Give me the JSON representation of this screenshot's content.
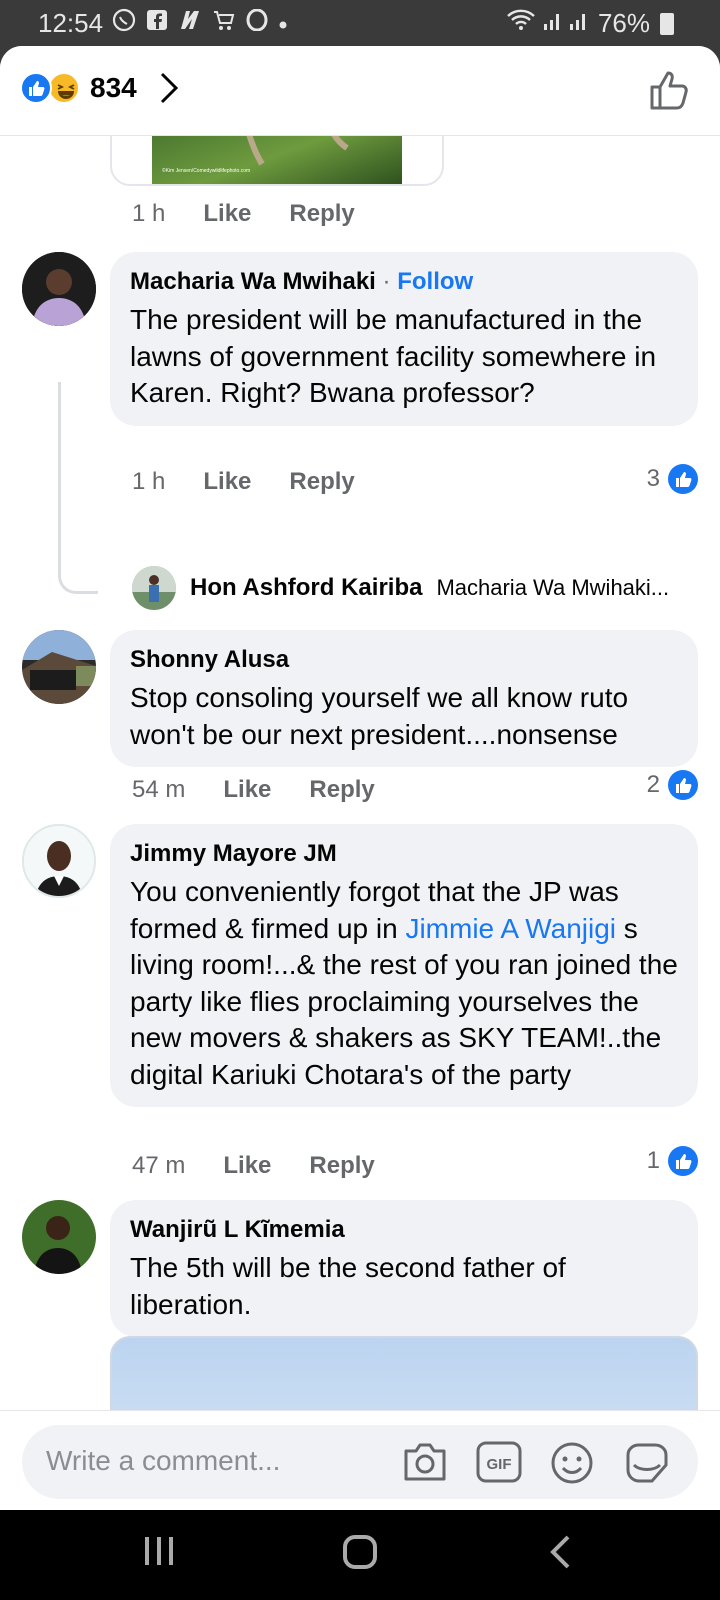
{
  "status_bar": {
    "time": "12:54",
    "battery": "76%",
    "notification_icons": [
      "whatsapp-icon",
      "facebook-icon",
      "news-icon",
      "shop-icon",
      "opera-icon"
    ]
  },
  "header": {
    "reactions": [
      "like",
      "haha"
    ],
    "reaction_count": "834"
  },
  "top_item": {
    "image_credit": "©Kim Jensen/Comedywildlifephoto.com",
    "time": "1 h",
    "like_label": "Like",
    "reply_label": "Reply"
  },
  "comments": [
    {
      "author": "Macharia Wa Mwihaki",
      "separator": "·",
      "follow_label": "Follow",
      "text": "The president will be manufactured in the lawns of government facility somewhere in Karen. Right? Bwana professor?",
      "time": "1 h",
      "like_label": "Like",
      "reply_label": "Reply",
      "likes": "3",
      "reply_preview": {
        "author": "Hon Ashford Kairiba",
        "text": "Macharia Wa Mwihaki..."
      }
    },
    {
      "author": "Shonny Alusa",
      "text": "Stop consoling yourself we all know ruto won't be our next president....nonsense",
      "time": "54 m",
      "like_label": "Like",
      "reply_label": "Reply",
      "likes": "2"
    },
    {
      "author": "Jimmy Mayore JM",
      "text_before": "You conveniently forgot that the JP was formed & firmed up in ",
      "mention": "Jimmie A Wanjigi",
      "text_after": " s living room!...& the rest of you ran joined the party like flies proclaiming yourselves the new movers & shakers as SKY TEAM!..the digital Kariuki Chotara's of the party",
      "time": "47 m",
      "like_label": "Like",
      "reply_label": "Reply",
      "likes": "1"
    },
    {
      "author": "Wanjirũ L Kĩmemia",
      "text": "The 5th will be the second father of liberation."
    }
  ],
  "composer": {
    "placeholder": "Write a comment...",
    "icons": [
      "camera-icon",
      "gif-icon",
      "emoji-icon",
      "sticker-icon"
    ]
  },
  "colors": {
    "accent": "#1877f2",
    "bubble": "#f0f2f5",
    "meta_text": "#65676b"
  }
}
